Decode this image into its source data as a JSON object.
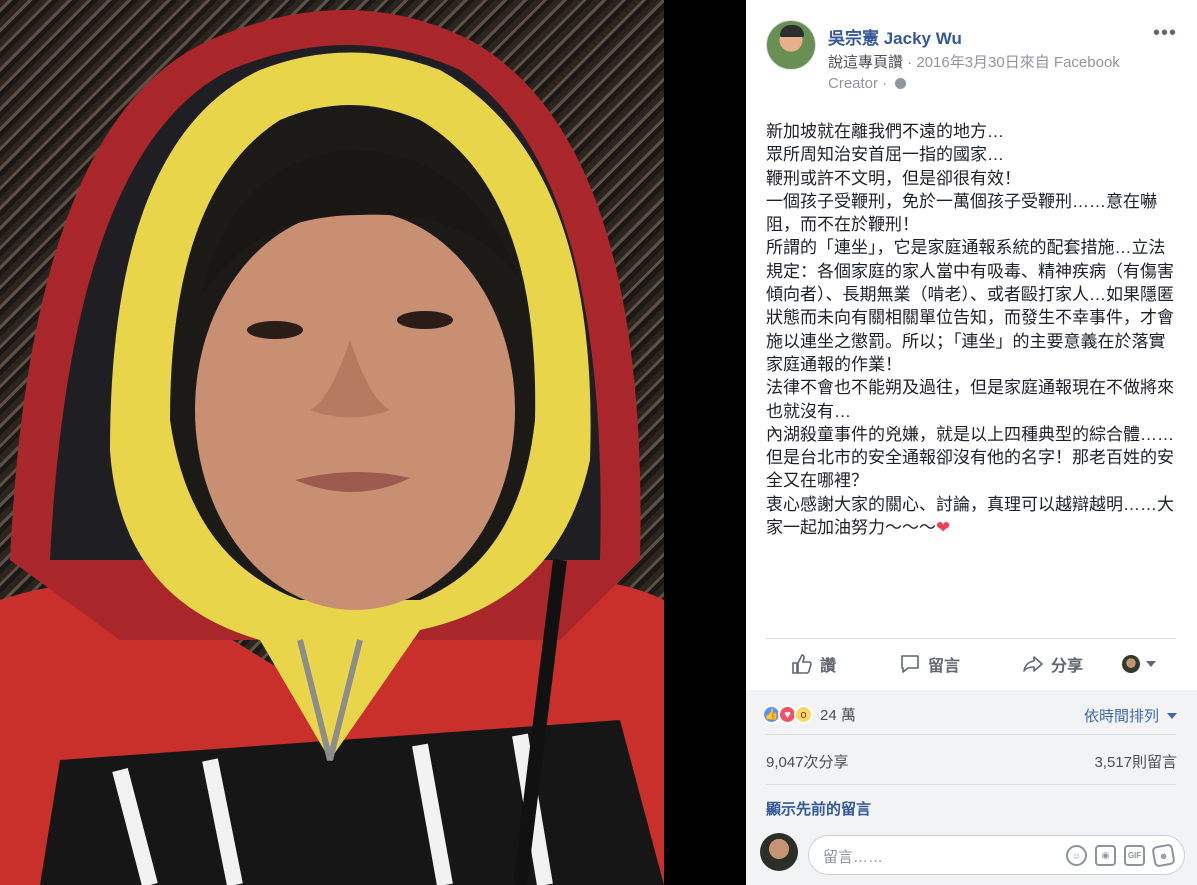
{
  "post": {
    "author": "吳宗憲 Jacky Wu",
    "meta_via": "說這專頁讚",
    "meta_line": "· 2016年3月30日來自 Facebook Creator ·",
    "body": "新加坡就在離我們不遠的地方…\n眾所周知治安首屈一指的國家…\n鞭刑或許不文明，但是卻很有效！\n一個孩子受鞭刑，免於一萬個孩子受鞭刑……意在嚇阻，而不在於鞭刑！\n所謂的「連坐」，它是家庭通報系統的配套措施…立法規定：各個家庭的家人當中有吸毒、精神疾病（有傷害傾向者）、長期無業（啃老）、或者毆打家人…如果隱匿狀態而未向有關相關單位告知，而發生不幸事件，才會施以連坐之懲罰。所以；「連坐」的主要意義在於落實家庭通報的作業！\n法律不會也不能朔及過往，但是家庭通報現在不做將來也就沒有…\n內湖殺童事件的兇嫌，就是以上四種典型的綜合體……但是台北市的安全通報卻沒有他的名字！那老百姓的安全又在哪裡？\n衷心感謝大家的關心、討論，真理可以越辯越明……大家一起加油努力～～～",
    "heart": "❤"
  },
  "actions": {
    "like": "讚",
    "comment": "留言",
    "share": "分享"
  },
  "stats": {
    "reactions_count": "24 萬",
    "sort_label": "依時間排列",
    "shares": "9,047次分享",
    "comments": "3,517則留言",
    "show_previous": "顯示先前的留言"
  },
  "composer": {
    "placeholder": "留言……",
    "gif_label": "GIF"
  },
  "colors": {
    "link": "#365899",
    "like_blue": "#5890ff",
    "love_red": "#f25268",
    "wow_yellow": "#fcd669",
    "hood_yellow": "#e9d54a",
    "hoodie_red": "#c9302c"
  }
}
